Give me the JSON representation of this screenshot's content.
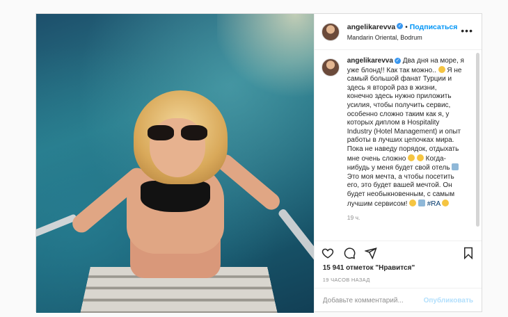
{
  "post": {
    "username": "angelikarevva",
    "follow_label": "Подписаться",
    "dot": "•",
    "location": "Mandarin Oriental, Bodrum",
    "more_label": "•••"
  },
  "caption": {
    "username": "angelikarevva",
    "lines": [
      "Два дня на море, я",
      "уже блонд!! Как так можно..",
      "Я не",
      "самый большой фанат Турции и",
      "здесь я второй раз в жизни,",
      "конечно здесь нужно приложить",
      "усилия, чтобы получить сервис,",
      "особенно сложно таким как я, у",
      "которых диплом в Hospitality",
      "Industry (Hotel Management) и опыт",
      "работы в лучших цепочках мира.",
      "Пока не наведу порядок, отдыхать",
      "мне очень сложно",
      "Когда-",
      "нибудь у меня будет свой отель",
      "Это моя мечта, а чтобы посетить",
      "его, это будет вашей мечтой. Он",
      "будет необыкновенным, с самым",
      "лучшим сервисом!",
      "#RA"
    ],
    "time": "19 ч."
  },
  "icons": [
    "heart-icon",
    "comment-icon",
    "share-icon",
    "bookmark-icon",
    "verified-icon",
    "more-icon"
  ],
  "likes_text": "15 941 отметок \"Нравится\"",
  "posted_ago": "19 ЧАСОВ НАЗАД",
  "comment_box": {
    "placeholder": "Добавьте комментарий...",
    "publish_label": "Опубликовать"
  },
  "colors": {
    "accent": "#0095f6",
    "publish_disabled": "#b2dffc",
    "verified": "#3897f0",
    "hashtag": "#00376b"
  }
}
